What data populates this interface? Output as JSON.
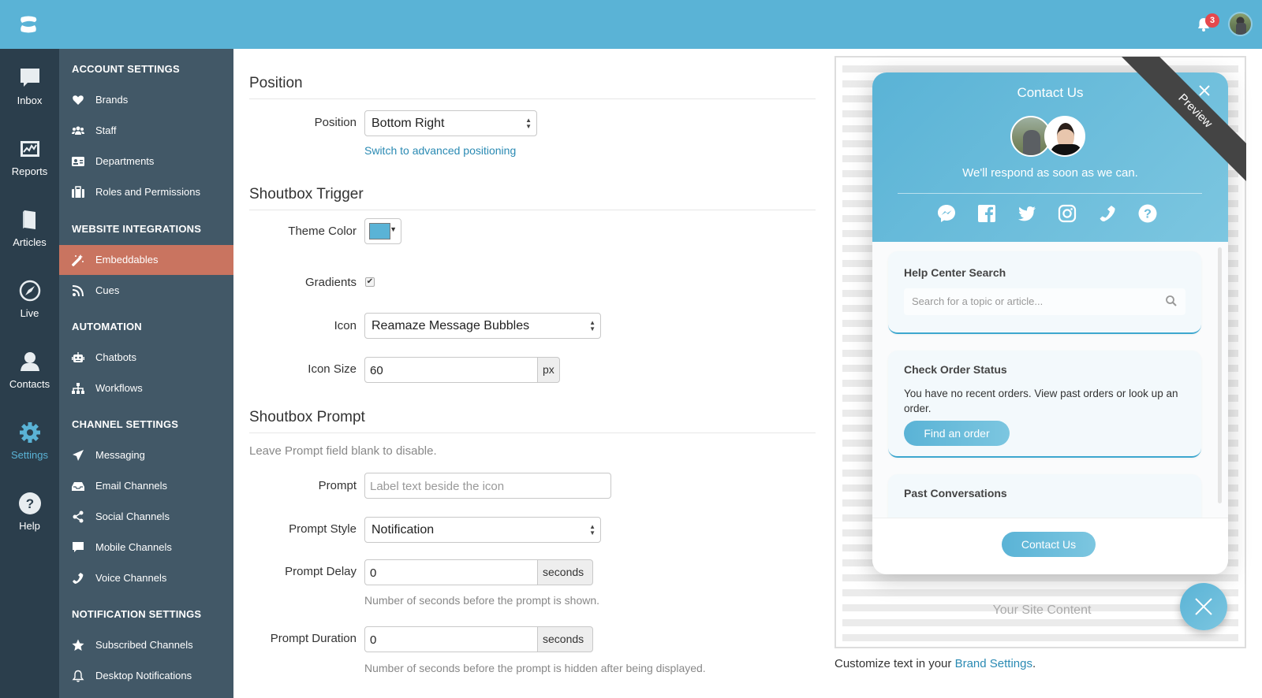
{
  "topbar": {
    "logo": "reamaze-logo-icon",
    "notifications_count": "3"
  },
  "rail": {
    "items": [
      {
        "label": "Inbox",
        "icon": "chat-bubble-icon"
      },
      {
        "label": "Reports",
        "icon": "chart-icon"
      },
      {
        "label": "Articles",
        "icon": "book-icon"
      },
      {
        "label": "Live",
        "icon": "compass-icon"
      },
      {
        "label": "Contacts",
        "icon": "person-icon"
      },
      {
        "label": "Settings",
        "icon": "gear-icon",
        "active": true
      },
      {
        "label": "Help",
        "icon": "question-circle-icon"
      }
    ]
  },
  "sidebar": {
    "sections": [
      {
        "title": "ACCOUNT SETTINGS",
        "items": [
          {
            "label": "Brands",
            "icon": "heart-icon"
          },
          {
            "label": "Staff",
            "icon": "users-icon"
          },
          {
            "label": "Departments",
            "icon": "id-card-icon"
          },
          {
            "label": "Roles and Permissions",
            "icon": "briefcase-icon"
          }
        ]
      },
      {
        "title": "WEBSITE INTEGRATIONS",
        "items": [
          {
            "label": "Embeddables",
            "icon": "magic-wand-icon",
            "active": true
          },
          {
            "label": "Cues",
            "icon": "rss-icon"
          }
        ]
      },
      {
        "title": "AUTOMATION",
        "items": [
          {
            "label": "Chatbots",
            "icon": "robot-icon"
          },
          {
            "label": "Workflows",
            "icon": "sitemap-icon"
          }
        ]
      },
      {
        "title": "CHANNEL SETTINGS",
        "items": [
          {
            "label": "Messaging",
            "icon": "paper-plane-icon"
          },
          {
            "label": "Email Channels",
            "icon": "inbox-tray-icon"
          },
          {
            "label": "Social Channels",
            "icon": "share-icon"
          },
          {
            "label": "Mobile Channels",
            "icon": "comment-icon"
          },
          {
            "label": "Voice Channels",
            "icon": "phone-icon"
          }
        ]
      },
      {
        "title": "NOTIFICATION SETTINGS",
        "items": [
          {
            "label": "Subscribed Channels",
            "icon": "star-icon"
          },
          {
            "label": "Desktop Notifications",
            "icon": "bell-icon"
          }
        ]
      }
    ]
  },
  "form": {
    "position": {
      "heading": "Position",
      "position_label": "Position",
      "position_value": "Bottom Right",
      "advanced_link": "Switch to advanced positioning"
    },
    "trigger": {
      "heading": "Shoutbox Trigger",
      "theme_color_label": "Theme Color",
      "theme_color": "#5ab3d6",
      "gradients_label": "Gradients",
      "gradients_checked": true,
      "gradients_check_glyph": "✔",
      "icon_label": "Icon",
      "icon_value": "Reamaze Message Bubbles",
      "icon_size_label": "Icon Size",
      "icon_size_value": "60",
      "icon_size_unit": "px"
    },
    "prompt": {
      "heading": "Shoutbox Prompt",
      "note": "Leave Prompt field blank to disable.",
      "prompt_label": "Prompt",
      "prompt_placeholder": "Label text beside the icon",
      "prompt_value": "",
      "style_label": "Prompt Style",
      "style_value": "Notification",
      "delay_label": "Prompt Delay",
      "delay_value": "0",
      "delay_unit": "seconds",
      "delay_help": "Number of seconds before the prompt is shown.",
      "duration_label": "Prompt Duration",
      "duration_value": "0",
      "duration_unit": "seconds",
      "duration_help": "Number of seconds before the prompt is hidden after being displayed."
    }
  },
  "preview": {
    "ribbon": "Preview",
    "site_content": "Your Site Content",
    "widget": {
      "title": "Contact Us",
      "subtitle": "We'll respond as soon as we can.",
      "social_icons": [
        "messenger-icon",
        "facebook-icon",
        "twitter-icon",
        "instagram-icon",
        "phone-icon",
        "question-circle-icon"
      ],
      "help_center": {
        "title": "Help Center Search",
        "placeholder": "Search for a topic or article..."
      },
      "order_status": {
        "title": "Check Order Status",
        "text": "You have no recent orders. View past orders or look up an order.",
        "button": "Find an order"
      },
      "past_conversations": {
        "title": "Past Conversations"
      },
      "contact_button": "Contact Us"
    },
    "customize_prefix": "Customize text in your ",
    "customize_link": "Brand Settings",
    "customize_suffix": "."
  }
}
